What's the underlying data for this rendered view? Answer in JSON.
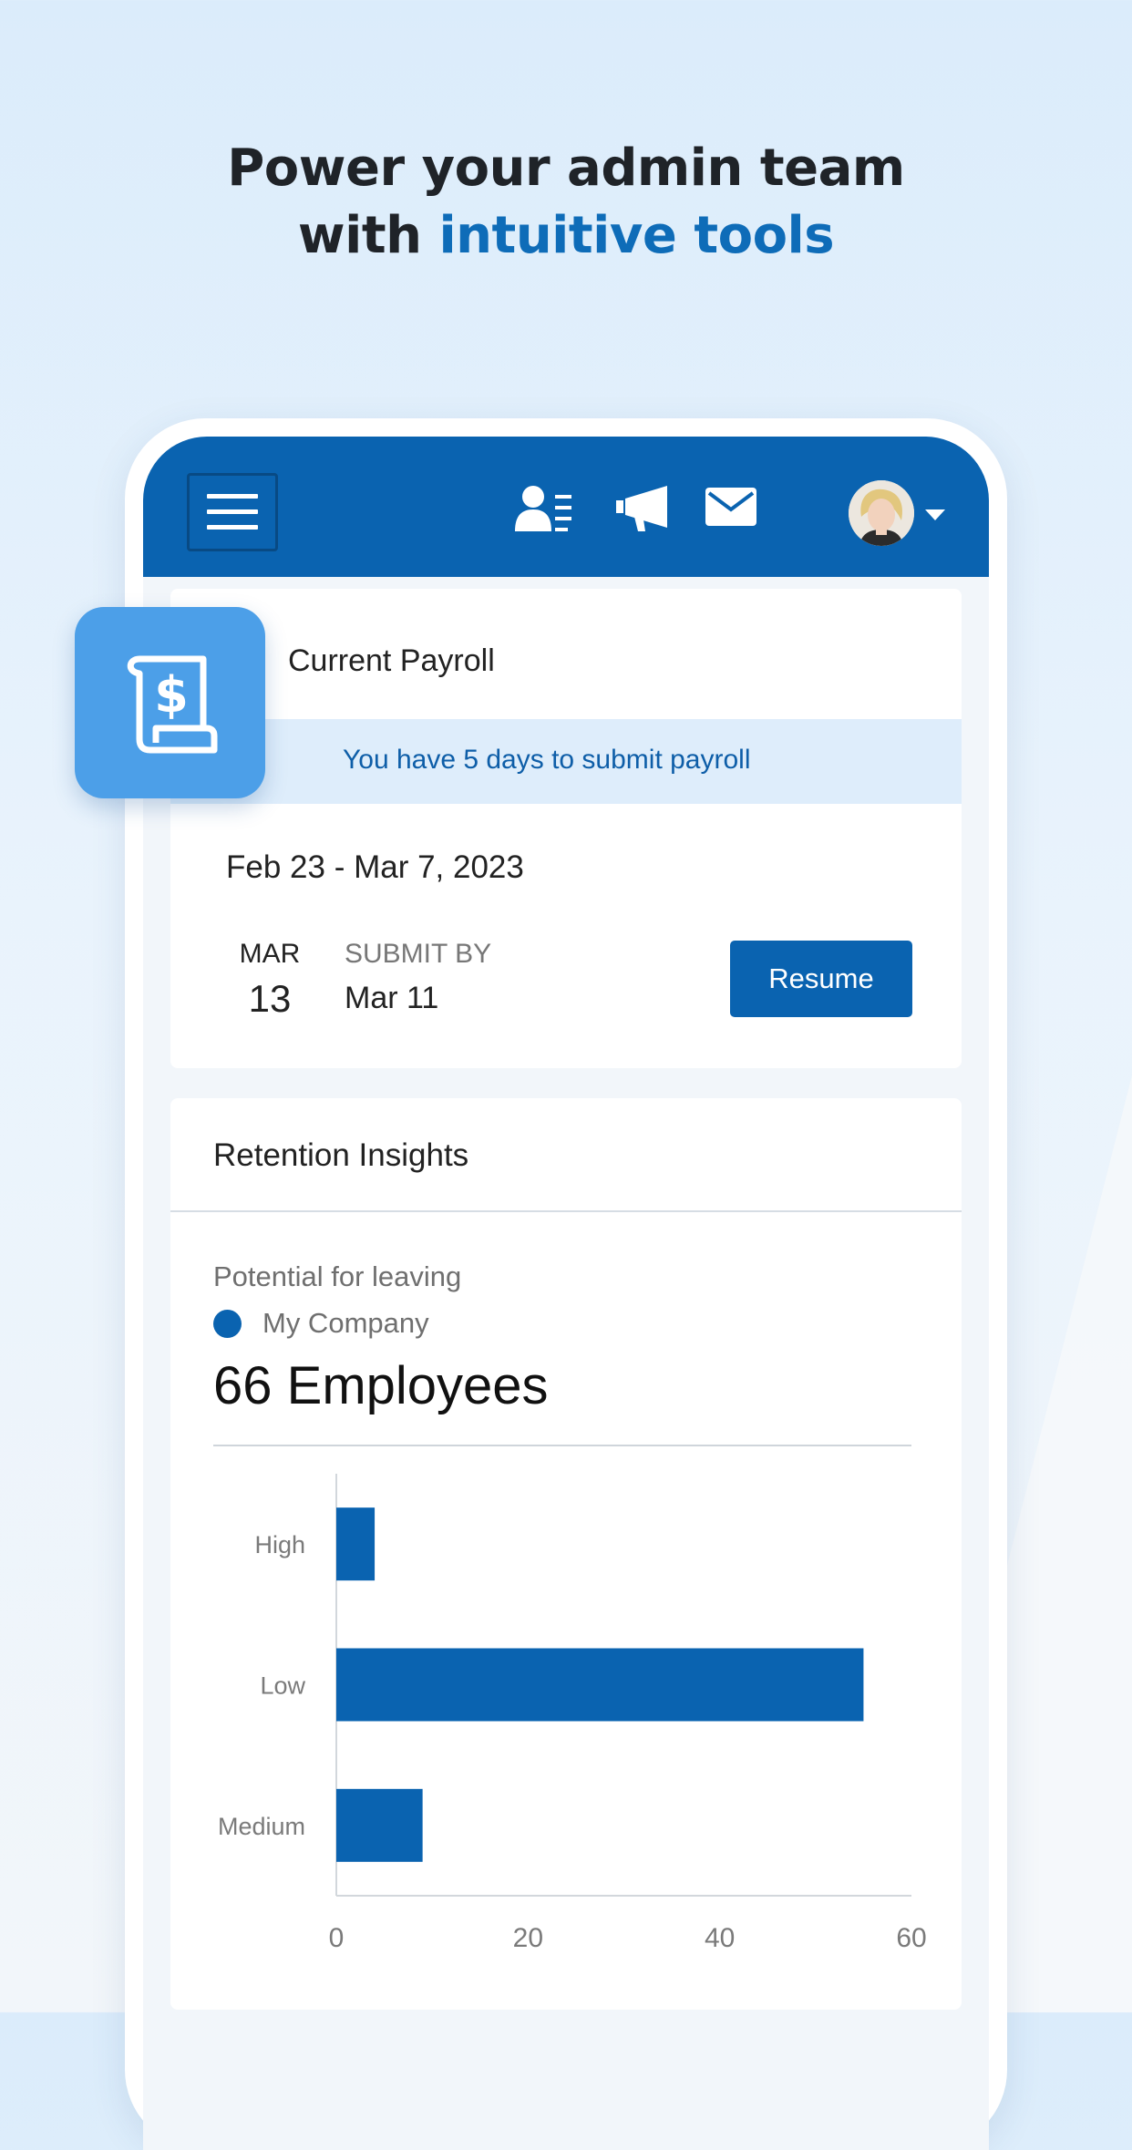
{
  "headline": {
    "line1": "Power your admin team",
    "line2_prefix": "with ",
    "line2_accent": "intuitive tools"
  },
  "colors": {
    "brand_blue": "#0a63b0",
    "accent_text": "#0e6cb8",
    "icon_tile": "#4c9fe8",
    "notice_bg": "#deedfb"
  },
  "appbar": {
    "icons": [
      "menu-icon",
      "employee-directory-icon",
      "megaphone-icon",
      "mail-icon",
      "avatar",
      "chevron-down-icon"
    ]
  },
  "payroll": {
    "icon": "payroll-document-dollar-icon",
    "title": "Current Payroll",
    "notice": "You have 5 days to submit payroll",
    "period": "Feb 23 - Mar 7, 2023",
    "pay_month": "MAR",
    "pay_day": "13",
    "submit_label": "SUBMIT BY",
    "submit_date": "Mar 11",
    "resume_label": "Resume"
  },
  "retention": {
    "title": "Retention Insights",
    "subtitle": "Potential for leaving",
    "legend": "My Company",
    "count": "66 Employees"
  },
  "chart_data": {
    "type": "bar",
    "orientation": "horizontal",
    "categories": [
      "High",
      "Low",
      "Medium"
    ],
    "series": [
      {
        "name": "My Company",
        "values": [
          4,
          55,
          9
        ]
      }
    ],
    "xlim": [
      0,
      60
    ],
    "xticks": [
      "0",
      "20",
      "40",
      "60"
    ],
    "grid": false,
    "color": "#0a63b0"
  }
}
